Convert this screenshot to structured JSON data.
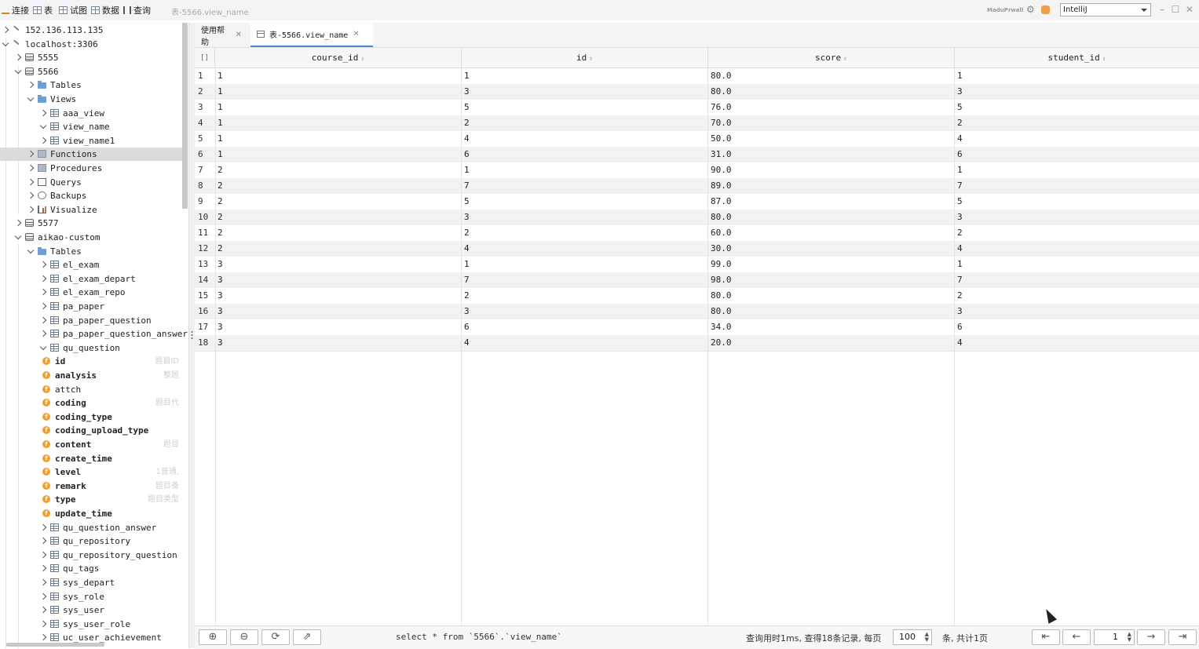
{
  "toolbar": {
    "items": [
      "连接",
      "表",
      "试图",
      "数据",
      "查询"
    ],
    "window_title": "表-5566.view_name",
    "brand": "MaduPrwall",
    "theme": "IntelliJ"
  },
  "tree": [
    {
      "label": "152.136.113.135",
      "icon": "conn",
      "depth": 0,
      "exp": "r"
    },
    {
      "label": "localhost:3306",
      "icon": "conn",
      "depth": 0,
      "exp": "d"
    },
    {
      "label": "5555",
      "icon": "db",
      "depth": 1,
      "exp": "r"
    },
    {
      "label": "5566",
      "icon": "db",
      "depth": 1,
      "exp": "d"
    },
    {
      "label": "Tables",
      "icon": "folder",
      "depth": 2,
      "exp": "r"
    },
    {
      "label": "Views",
      "icon": "folder",
      "depth": 2,
      "exp": "d"
    },
    {
      "label": "aaa_view",
      "icon": "table",
      "depth": 3,
      "exp": "r"
    },
    {
      "label": "view_name",
      "icon": "table",
      "depth": 3,
      "exp": "d"
    },
    {
      "label": "view_name1",
      "icon": "table",
      "depth": 3,
      "exp": "r"
    },
    {
      "label": "Functions",
      "icon": "func",
      "depth": 2,
      "exp": "r",
      "selected": true
    },
    {
      "label": "Procedures",
      "icon": "func",
      "depth": 2,
      "exp": "r"
    },
    {
      "label": "Querys",
      "icon": "query",
      "depth": 2,
      "exp": "r"
    },
    {
      "label": "Backups",
      "icon": "backup",
      "depth": 2,
      "exp": "r"
    },
    {
      "label": "Visualize",
      "icon": "viz",
      "depth": 2,
      "exp": "r"
    },
    {
      "label": "5577",
      "icon": "db",
      "depth": 1,
      "exp": "r"
    },
    {
      "label": "aikao-custom",
      "icon": "db",
      "depth": 1,
      "exp": "d"
    },
    {
      "label": "Tables",
      "icon": "folder",
      "depth": 2,
      "exp": "d"
    },
    {
      "label": "el_exam",
      "icon": "table",
      "depth": 3,
      "exp": "r"
    },
    {
      "label": "el_exam_depart",
      "icon": "table",
      "depth": 3,
      "exp": "r"
    },
    {
      "label": "el_exam_repo",
      "icon": "table",
      "depth": 3,
      "exp": "r"
    },
    {
      "label": "pa_paper",
      "icon": "table",
      "depth": 3,
      "exp": "r"
    },
    {
      "label": "pa_paper_question",
      "icon": "table",
      "depth": 3,
      "exp": "r"
    },
    {
      "label": "pa_paper_question_answer",
      "icon": "table",
      "depth": 3,
      "exp": "r"
    },
    {
      "label": "qu_question",
      "icon": "table",
      "depth": 3,
      "exp": "d"
    },
    {
      "label": "id",
      "icon": "field",
      "depth": 4,
      "bold": true,
      "comment": "题目ID"
    },
    {
      "label": "analysis",
      "icon": "field",
      "depth": 4,
      "bold": true,
      "comment": "整题"
    },
    {
      "label": "attch",
      "icon": "field",
      "depth": 4
    },
    {
      "label": "coding",
      "icon": "field",
      "depth": 4,
      "bold": true,
      "comment": "题目代"
    },
    {
      "label": "coding_type",
      "icon": "field",
      "depth": 4,
      "bold": true
    },
    {
      "label": "coding_upload_type",
      "icon": "field",
      "depth": 4,
      "bold": true
    },
    {
      "label": "content",
      "icon": "field",
      "depth": 4,
      "bold": true,
      "comment": "题目"
    },
    {
      "label": "create_time",
      "icon": "field",
      "depth": 4,
      "bold": true
    },
    {
      "label": "level",
      "icon": "field",
      "depth": 4,
      "bold": true,
      "comment": "1普通,"
    },
    {
      "label": "remark",
      "icon": "field",
      "depth": 4,
      "bold": true,
      "comment": "题目备"
    },
    {
      "label": "type",
      "icon": "field",
      "depth": 4,
      "bold": true,
      "comment": "题目类型"
    },
    {
      "label": "update_time",
      "icon": "field",
      "depth": 4,
      "bold": true
    },
    {
      "label": "qu_question_answer",
      "icon": "table",
      "depth": 3,
      "exp": "r"
    },
    {
      "label": "qu_repository",
      "icon": "table",
      "depth": 3,
      "exp": "r"
    },
    {
      "label": "qu_repository_question",
      "icon": "table",
      "depth": 3,
      "exp": "r"
    },
    {
      "label": "qu_tags",
      "icon": "table",
      "depth": 3,
      "exp": "r"
    },
    {
      "label": "sys_depart",
      "icon": "table",
      "depth": 3,
      "exp": "r"
    },
    {
      "label": "sys_role",
      "icon": "table",
      "depth": 3,
      "exp": "r"
    },
    {
      "label": "sys_user",
      "icon": "table",
      "depth": 3,
      "exp": "r"
    },
    {
      "label": "sys_user_role",
      "icon": "table",
      "depth": 3,
      "exp": "r"
    },
    {
      "label": "uc_user_achievement",
      "icon": "table",
      "depth": 3,
      "exp": "r"
    }
  ],
  "tabs": [
    {
      "label": "使用帮助",
      "active": false
    },
    {
      "label": "表-5566.view_name",
      "active": true
    }
  ],
  "grid": {
    "corner": "[]",
    "columns": [
      "course_id",
      "id",
      "score",
      "student_id"
    ],
    "rows": [
      [
        "1",
        "1",
        "1",
        "80.0",
        "1"
      ],
      [
        "2",
        "1",
        "3",
        "80.0",
        "3"
      ],
      [
        "3",
        "1",
        "5",
        "76.0",
        "5"
      ],
      [
        "4",
        "1",
        "2",
        "70.0",
        "2"
      ],
      [
        "5",
        "1",
        "4",
        "50.0",
        "4"
      ],
      [
        "6",
        "1",
        "6",
        "31.0",
        "6"
      ],
      [
        "7",
        "2",
        "1",
        "90.0",
        "1"
      ],
      [
        "8",
        "2",
        "7",
        "89.0",
        "7"
      ],
      [
        "9",
        "2",
        "5",
        "87.0",
        "5"
      ],
      [
        "10",
        "2",
        "3",
        "80.0",
        "3"
      ],
      [
        "11",
        "2",
        "2",
        "60.0",
        "2"
      ],
      [
        "12",
        "2",
        "4",
        "30.0",
        "4"
      ],
      [
        "13",
        "3",
        "1",
        "99.0",
        "1"
      ],
      [
        "14",
        "3",
        "7",
        "98.0",
        "7"
      ],
      [
        "15",
        "3",
        "2",
        "80.0",
        "2"
      ],
      [
        "16",
        "3",
        "3",
        "80.0",
        "3"
      ],
      [
        "17",
        "3",
        "6",
        "34.0",
        "6"
      ],
      [
        "18",
        "3",
        "4",
        "20.0",
        "4"
      ]
    ]
  },
  "footer": {
    "sql": "select * from `5566`.`view_name`",
    "status": "查询用时1ms, 查得18条记录, 每页",
    "page_size": "100",
    "page_suffix": "条, 共计1页",
    "page": "1"
  }
}
